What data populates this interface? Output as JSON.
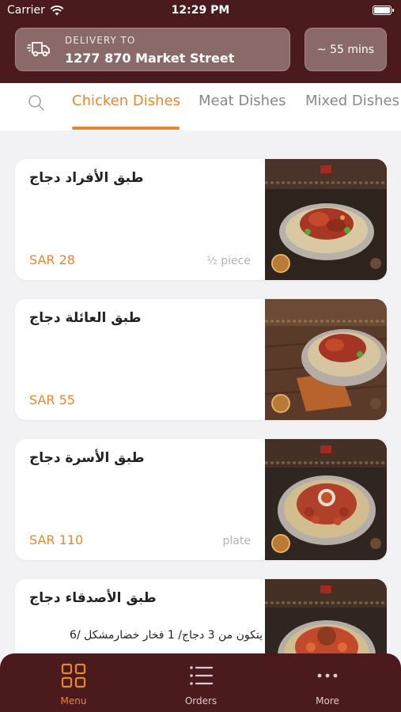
{
  "status_bar": {
    "carrier": "Carrier",
    "time": "12:29 PM"
  },
  "header": {
    "delivery_label": "DELIVERY TO",
    "delivery_address": "1277 870 Market Street",
    "eta": "~ 55 mins"
  },
  "categories": {
    "tabs": [
      {
        "label": "Chicken Dishes",
        "active": true
      },
      {
        "label": "Meat Dishes",
        "active": false
      },
      {
        "label": "Mixed Dishes",
        "active": false
      }
    ]
  },
  "dishes": [
    {
      "name": "طبق الأفراد دجاج",
      "description": "",
      "price": "SAR 28",
      "unit": "½ piece"
    },
    {
      "name": "طبق العائلة دجاج",
      "description": "",
      "price": "SAR 55",
      "unit": ""
    },
    {
      "name": "طبق الأسرة دجاج",
      "description": "",
      "price": "SAR 110",
      "unit": "plate"
    },
    {
      "name": "طبق الأصدقاء دجاج",
      "description": "يتكون من 3 دجاج/ 1 فخار خضارمشكل /6",
      "price": "",
      "unit": ""
    }
  ],
  "tabbar": {
    "items": [
      {
        "label": "Menu",
        "icon": "grid-icon",
        "active": true
      },
      {
        "label": "Orders",
        "icon": "list-icon",
        "active": false
      },
      {
        "label": "More",
        "icon": "more-icon",
        "active": false
      }
    ]
  },
  "colors": {
    "brand": "#4b1a1c",
    "accent": "#e8872e",
    "header_box": "#8a6a69"
  }
}
